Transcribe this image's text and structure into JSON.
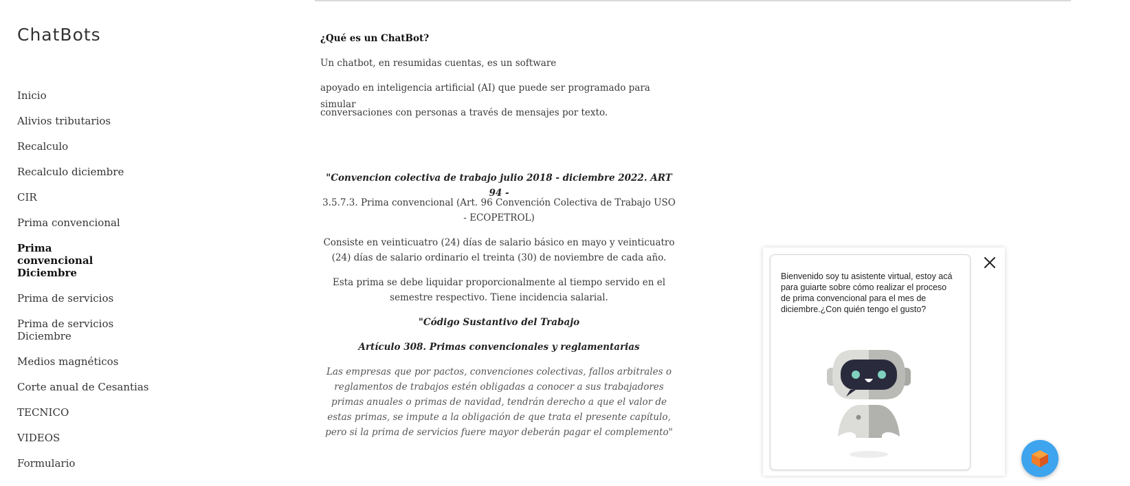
{
  "site": {
    "title": "ChatBots"
  },
  "nav": {
    "items": [
      {
        "label": "Inicio"
      },
      {
        "label": "Alivios tributarios"
      },
      {
        "label": "Recalculo"
      },
      {
        "label": "Recalculo diciembre"
      },
      {
        "label": "CIR"
      },
      {
        "label": "Prima convencional"
      },
      {
        "label": "Prima convencional Diciembre",
        "active": true
      },
      {
        "label": "Prima de servicios"
      },
      {
        "label": "Prima de servicios Diciembre"
      },
      {
        "label": "Medios magnéticos"
      },
      {
        "label": "Corte anual de Cesantias"
      },
      {
        "label": "TECNICO"
      },
      {
        "label": "VIDEOS"
      },
      {
        "label": "Formulario"
      }
    ]
  },
  "main": {
    "question_title": "¿Qué es un ChatBot?",
    "intro_lines": [
      "Un chatbot, en resumidas cuentas, es un software",
      "apoyado en inteligencia artificial (AI) que puede ser programado para simular",
      "conversaciones con personas a través de mensajes por texto."
    ],
    "convention_title": "\"Convencion colectiva de trabajo julio 2018 - diciembre 2022.  ART 94 -",
    "article_ref": "3.5.7.3. Prima convencional (Art. 96 Convención Colectiva de Trabajo USO - ECOPETROL)",
    "consists": "Consiste en veinticuatro (24) días de salario básico en mayo y veinticuatro (24) días de salario ordinario el treinta (30) de noviembre de cada año.",
    "proportional": "Esta prima se debe liquidar proporcionalmente al tiempo servido en el semestre respectivo. Tiene incidencia salarial.",
    "code_title": "\"Código Sustantivo del Trabajo",
    "article_308": "Artículo 308. Primas convencionales y reglamentarias",
    "quote": "Las empresas que por pactos, convenciones colectivas, fallos arbitrales o reglamentos de trabajos estén obligadas a conocer a sus trabajadores primas anuales o primas de navidad, tendrán derecho a que el valor de estas primas, se impute a la obligación de que trata el presente capítulo, pero si la prima de servicios fuere mayor deberán pagar el complemento\""
  },
  "chat": {
    "message": "Bienvenido soy tu asistente virtual, estoy acá para guiarte sobre cómo realizar el proceso de prima convencional para el mes de diciembre.¿Con quién tengo el gusto?",
    "close_icon": "close-icon",
    "launcher_icon": "cube-icon",
    "launcher_color": "#3fa4ee",
    "robot_icon": "robot-icon"
  }
}
